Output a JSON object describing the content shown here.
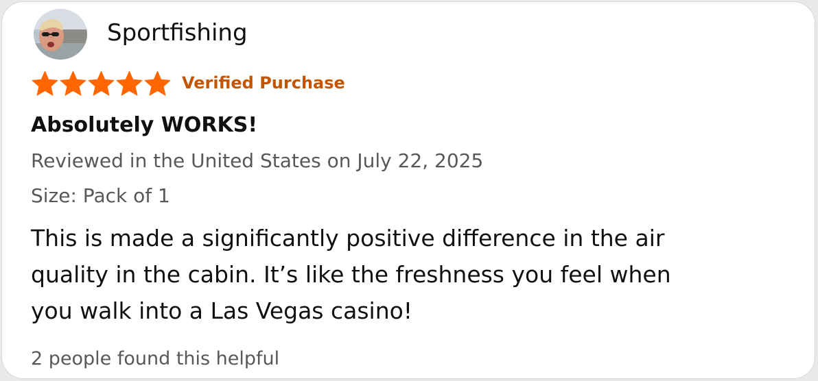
{
  "review": {
    "username": "Sportfishing",
    "avatar_icon": "user-avatar-photo",
    "rating": 5,
    "rating_max": 5,
    "star_color": "#ff6600",
    "verified_label": "Verified Purchase",
    "verified_color": "#c45500",
    "title": "Absolutely WORKS!",
    "date_line": "Reviewed in the United States on July 22, 2025",
    "variant_line": "Size: Pack of 1",
    "body_lines": [
      "This is made a significantly positive difference in the air",
      "quality in the cabin. It’s like the freshness you feel when",
      "you walk into a Las Vegas casino!"
    ],
    "helpful_text": "2 people found this helpful"
  }
}
